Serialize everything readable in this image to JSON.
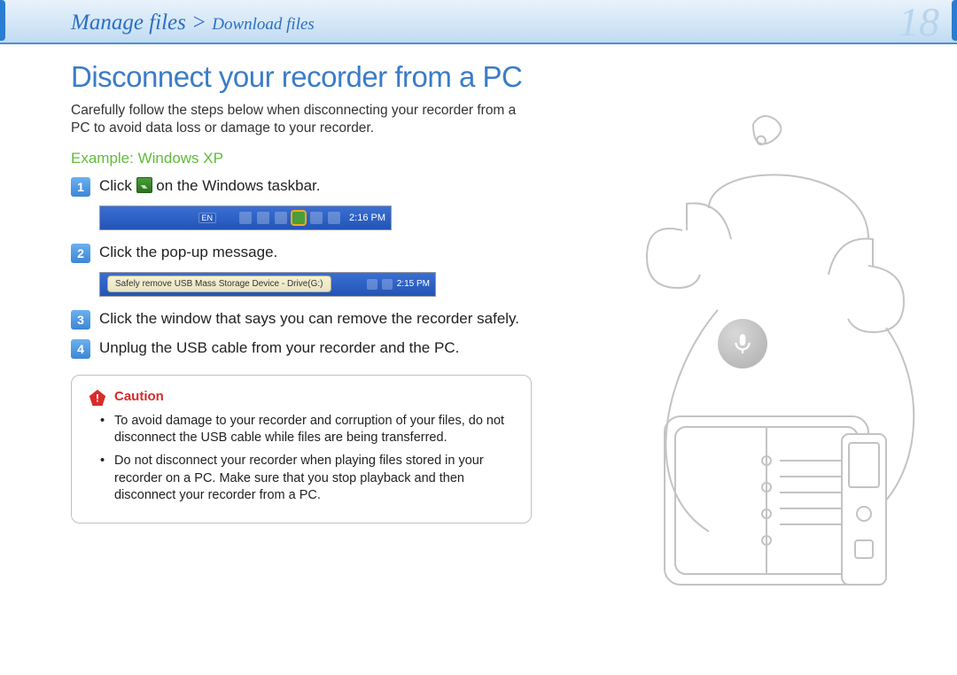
{
  "header": {
    "breadcrumb_main": "Manage files",
    "breadcrumb_sep": ">",
    "breadcrumb_sub": "Download files",
    "page_number": "18"
  },
  "title": "Disconnect your recorder from a PC",
  "intro": "Carefully follow the steps below when disconnecting your recorder from a PC to avoid data loss or damage to your recorder.",
  "example_label": "Example: Windows XP",
  "steps": {
    "s1a": "Click ",
    "s1b": " on the Windows taskbar.",
    "s2": "Click the pop-up message.",
    "s3": "Click the window that says you can remove the recorder safely.",
    "s4": "Unplug the USB cable from your recorder and the PC."
  },
  "taskbar1": {
    "lang": "EN",
    "time": "2:16 PM"
  },
  "popup": {
    "balloon": "Safely remove USB Mass Storage Device - Drive(G:)",
    "time": "2:15 PM"
  },
  "caution": {
    "label": "Caution",
    "items": [
      "To avoid damage to your recorder and corruption of your files, do not disconnect the USB cable while files are being transferred.",
      "Do not disconnect your recorder when playing files stored in your recorder on a PC. Make sure that you stop playback and then disconnect your recorder from a PC."
    ]
  }
}
